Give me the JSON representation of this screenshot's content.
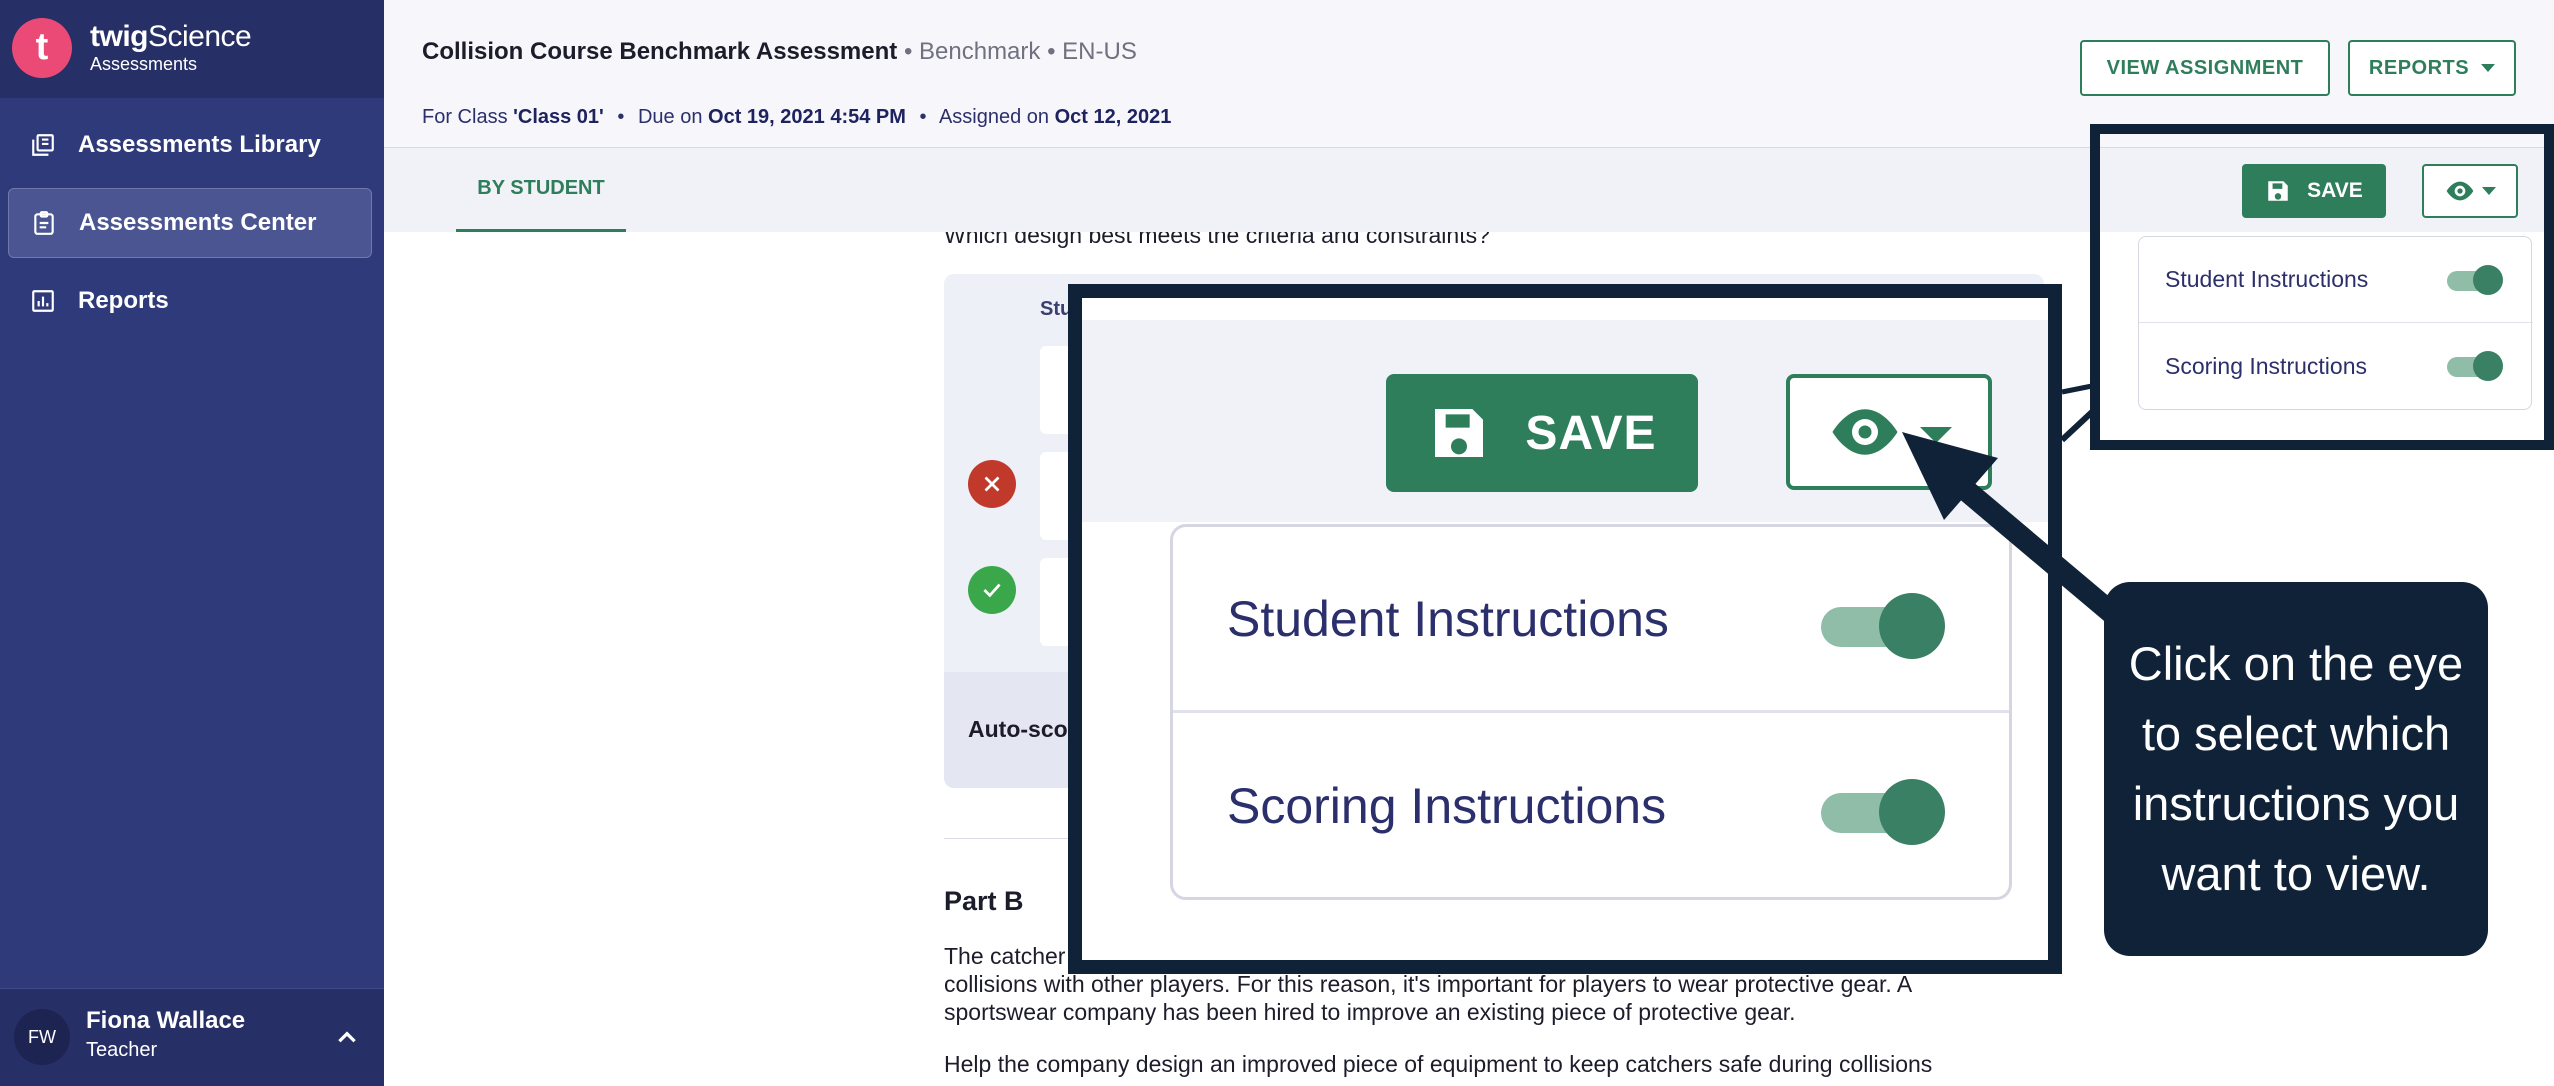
{
  "brand": {
    "logo_letter": "t",
    "name_prefix": "twig",
    "name_suffix": "Science",
    "subtitle": "Assessments"
  },
  "sidebar": {
    "items": [
      {
        "label": "Assessments Library",
        "icon": "library-icon"
      },
      {
        "label": "Assessments Center",
        "icon": "clipboard-icon",
        "active": true
      },
      {
        "label": "Reports",
        "icon": "chart-icon"
      }
    ],
    "user": {
      "initials": "FW",
      "name": "Fiona Wallace",
      "role": "Teacher"
    }
  },
  "header": {
    "title": "Collision Course Benchmark Assessment",
    "type": "Benchmark",
    "locale": "EN-US",
    "meta": {
      "class_prefix": "For Class ",
      "class_name": "'Class 01'",
      "due_prefix": "Due on ",
      "due_date": "Oct 19, 2021 4:54 PM",
      "assigned_prefix": "Assigned on ",
      "assigned_date": "Oct 12, 2021"
    },
    "view_assignment_label": "VIEW ASSIGNMENT",
    "reports_label": "REPORTS"
  },
  "tabs": [
    {
      "label": "BY STUDENT",
      "active": true
    }
  ],
  "toolbar": {
    "save_label": "SAVE"
  },
  "instructions_menu": {
    "items": [
      {
        "label": "Student Instructions",
        "enabled": true
      },
      {
        "label": "Scoring Instructions",
        "enabled": true
      }
    ]
  },
  "content": {
    "question": "Which design best meets the criteria and constraints?",
    "panel_header": "Stu",
    "autoscore_label": "Auto-sco",
    "part_b_title": "Part B",
    "para1_line1": "The catcher",
    "para1_line2": "collisions with other players. For this reason, it's important for players to wear protective gear. A",
    "para1_line3": "sportswear company has been hired to improve an existing piece of protective gear.",
    "para2": "Help the company design an improved piece of equipment to keep catchers safe during collisions"
  },
  "callout": {
    "tooltip": "Click on the eye to select which instructions you want to view."
  },
  "colors": {
    "sidebar": "#2f3a7a",
    "accent_green": "#2e7d5b",
    "callout_navy": "#102238",
    "brand_pink": "#ec4a76",
    "error_red": "#c0392b",
    "success_green": "#3aa84a"
  }
}
